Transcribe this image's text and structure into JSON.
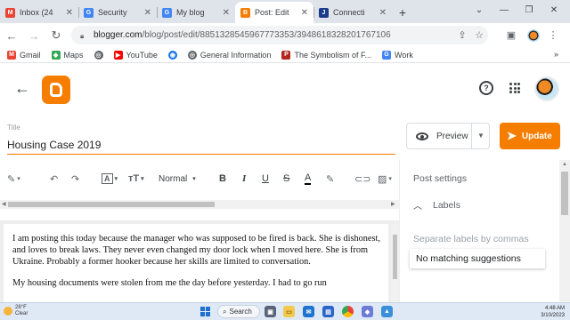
{
  "browser": {
    "tabs": [
      {
        "title": "Inbox (24",
        "favicon": "gmail-icon",
        "color": "#ea4335",
        "active": false
      },
      {
        "title": "Security",
        "favicon": "google-icon",
        "color": "#4285f4",
        "active": false
      },
      {
        "title": "My blog",
        "favicon": "google-icon",
        "color": "#4285f4",
        "active": false
      },
      {
        "title": "Post: Edit",
        "favicon": "blogger-icon",
        "color": "#f57d00",
        "active": true
      },
      {
        "title": "Connecti",
        "favicon": "j-icon",
        "color": "#1b3c8c",
        "active": false
      }
    ],
    "new_tab": "+",
    "url_host": "blogger.com",
    "url_path": "/blog/post/edit/8851328545967773353/3948618328201767106"
  },
  "bookmarks": [
    {
      "label": "Gmail",
      "icon": "gmail-icon",
      "color": "#ea4335"
    },
    {
      "label": "Maps",
      "icon": "maps-icon",
      "color": "#34a853"
    },
    {
      "label": "",
      "icon": "globe-icon",
      "color": "#5f6368"
    },
    {
      "label": "YouTube",
      "icon": "youtube-icon",
      "color": "#ff0000"
    },
    {
      "label": "",
      "icon": "compass-icon",
      "color": "#1a73e8"
    },
    {
      "label": "General Information",
      "icon": "globe-icon",
      "color": "#5f6368"
    },
    {
      "label": "The Symbolism of F...",
      "icon": "pg-icon",
      "color": "#b3261e"
    },
    {
      "label": "Work",
      "icon": "google-icon",
      "color": "#4285f4"
    }
  ],
  "editor": {
    "title_label": "Title",
    "title": "Housing Case 2019",
    "preview_label": "Preview",
    "update_label": "Update",
    "format_label": "Normal",
    "paragraphs": [
      " I am posting this today because the manager who was supposed to be fired is back. She is dishonest, and loves to break laws. They never even changed my door lock when I moved here.  She is from Ukraine.  Probably a former hooker because her skills are limited to conversation.",
      "My housing documents were stolen from me the day before yesterday.  I had to go run"
    ]
  },
  "side_panel": {
    "title": "Post settings",
    "labels_heading": "Labels",
    "labels_placeholder": "Separate labels by commas",
    "suggestion": "No matching suggestions"
  },
  "taskbar": {
    "temp": "28°F",
    "condition": "Clear",
    "search_label": "Search",
    "time": "4:48 AM",
    "date": "3/10/2023"
  }
}
